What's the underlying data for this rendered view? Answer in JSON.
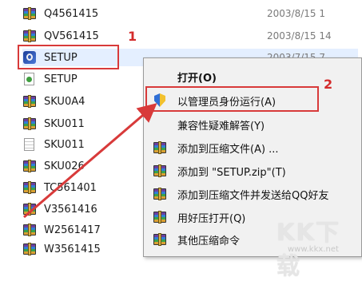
{
  "files": [
    {
      "name": "Q4561415",
      "date": "2003/8/15 1",
      "icon": "archive-icon"
    },
    {
      "name": "QV561415",
      "date": "2003/8/15 14",
      "icon": "archive-icon"
    },
    {
      "name": "SETUP",
      "date": "2003/7/15 7",
      "icon": "setup-exe-icon"
    },
    {
      "name": "SETUP",
      "date": "",
      "icon": "config-file-icon"
    },
    {
      "name": "SKU0A4",
      "date": "",
      "icon": "archive-icon"
    },
    {
      "name": "SKU011",
      "date": "",
      "icon": "archive-icon"
    },
    {
      "name": "SKU011",
      "date": "",
      "icon": "document-icon"
    },
    {
      "name": "SKU026",
      "date": "",
      "icon": "archive-icon"
    },
    {
      "name": "TC561401",
      "date": "",
      "icon": "archive-icon"
    },
    {
      "name": "V3561416",
      "date": "",
      "icon": "archive-icon"
    },
    {
      "name": "W2561417",
      "date": "",
      "icon": "archive-icon"
    },
    {
      "name": "W3561415",
      "date": "",
      "icon": "archive-icon"
    }
  ],
  "context_menu": {
    "items": [
      {
        "label": "打开(O)",
        "icon": ""
      },
      {
        "label": "以管理员身份运行(A)",
        "icon": "uac-shield-icon"
      },
      {
        "label": "兼容性疑难解答(Y)",
        "icon": ""
      },
      {
        "label": "添加到压缩文件(A) ...",
        "icon": "archive-icon"
      },
      {
        "label": "添加到 \"SETUP.zip\"(T)",
        "icon": "archive-icon"
      },
      {
        "label": "添加到压缩文件并发送给QQ好友",
        "icon": "archive-icon"
      },
      {
        "label": "用好压打开(Q)",
        "icon": "archive-icon"
      },
      {
        "label": "其他压缩命令",
        "icon": "archive-icon"
      }
    ]
  },
  "annotations": {
    "step1": "1",
    "step2": "2",
    "color": "#d83a3a"
  },
  "watermark": {
    "text": "KK下载",
    "url": "www.kkx.net"
  }
}
